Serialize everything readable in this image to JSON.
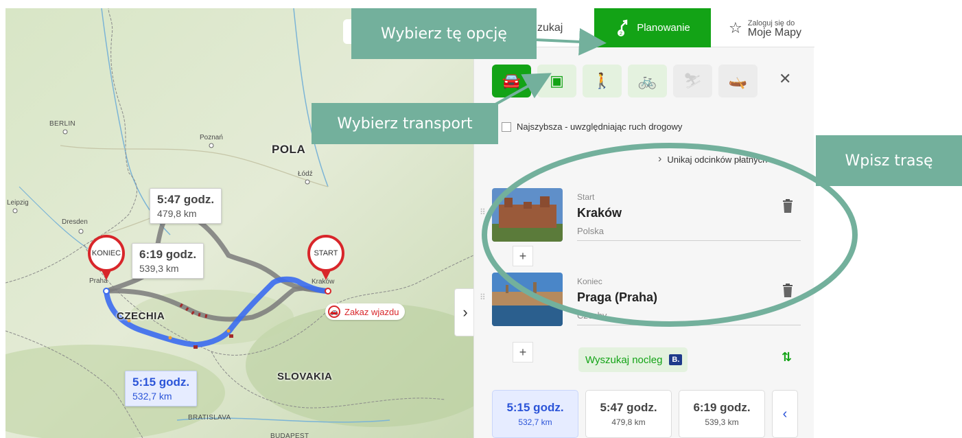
{
  "map": {
    "cities": {
      "berlin": "BERLIN",
      "poznan": "Poznań",
      "lodz": "Łódź",
      "leipzig": "Leipzig",
      "dresden": "Dresden",
      "praha": "Praha",
      "krakow": "Kraków",
      "bratislava": "BRATISLAVA",
      "budapest": "BUDAPEST"
    },
    "countries": {
      "poland": "POLA",
      "czechia": "CZECHIA",
      "slovakia": "SLOVAKIA"
    },
    "route_boxes": [
      {
        "time": "5:47 godz.",
        "distance": "479,8 km"
      },
      {
        "time": "6:19 godz.",
        "distance": "539,3 km"
      },
      {
        "time": "5:15 godz.",
        "distance": "532,7 km"
      }
    ],
    "pin_end": "KONIEC",
    "pin_start": "START",
    "zakaz_label": "Zakaz wjazdu",
    "colors": {
      "route_selected": "#3b6cf0",
      "route_alt": "#7b7b7b",
      "pin": "#d8262a"
    }
  },
  "panel": {
    "tabs": {
      "search": "zukaj",
      "planning": "Planowanie",
      "mymaps_line1": "Zaloguj się do",
      "mymaps_line2": "Moje Mapy"
    },
    "modes": [
      "car-icon",
      "bus-icon",
      "walk-icon",
      "bike-icon",
      "ski-icon",
      "boat-icon"
    ],
    "close": "✕",
    "fastest_label": "Najszybsza - uwzględniając ruch drogowy",
    "avoid_label": "Unikaj odcinków płatnych",
    "start": {
      "label": "Start",
      "name": "Kraków",
      "country": "Polska"
    },
    "end": {
      "label": "Koniec",
      "name": "Praga (Praha)",
      "country": "Czechy"
    },
    "nocleg_label": "Wyszukaj nocleg",
    "nocleg_badge": "B.",
    "route_cards": [
      {
        "time": "5:15 godz.",
        "distance": "532,7 km"
      },
      {
        "time": "5:47 godz.",
        "distance": "479,8 km"
      },
      {
        "time": "6:19 godz.",
        "distance": "539,3 km"
      }
    ],
    "accent": "#13a316"
  },
  "annotations": {
    "choose_option": "Wybierz tę opcję",
    "choose_transport": "Wybierz transport",
    "enter_route": "Wpisz trasę",
    "color": "#73b09c"
  }
}
